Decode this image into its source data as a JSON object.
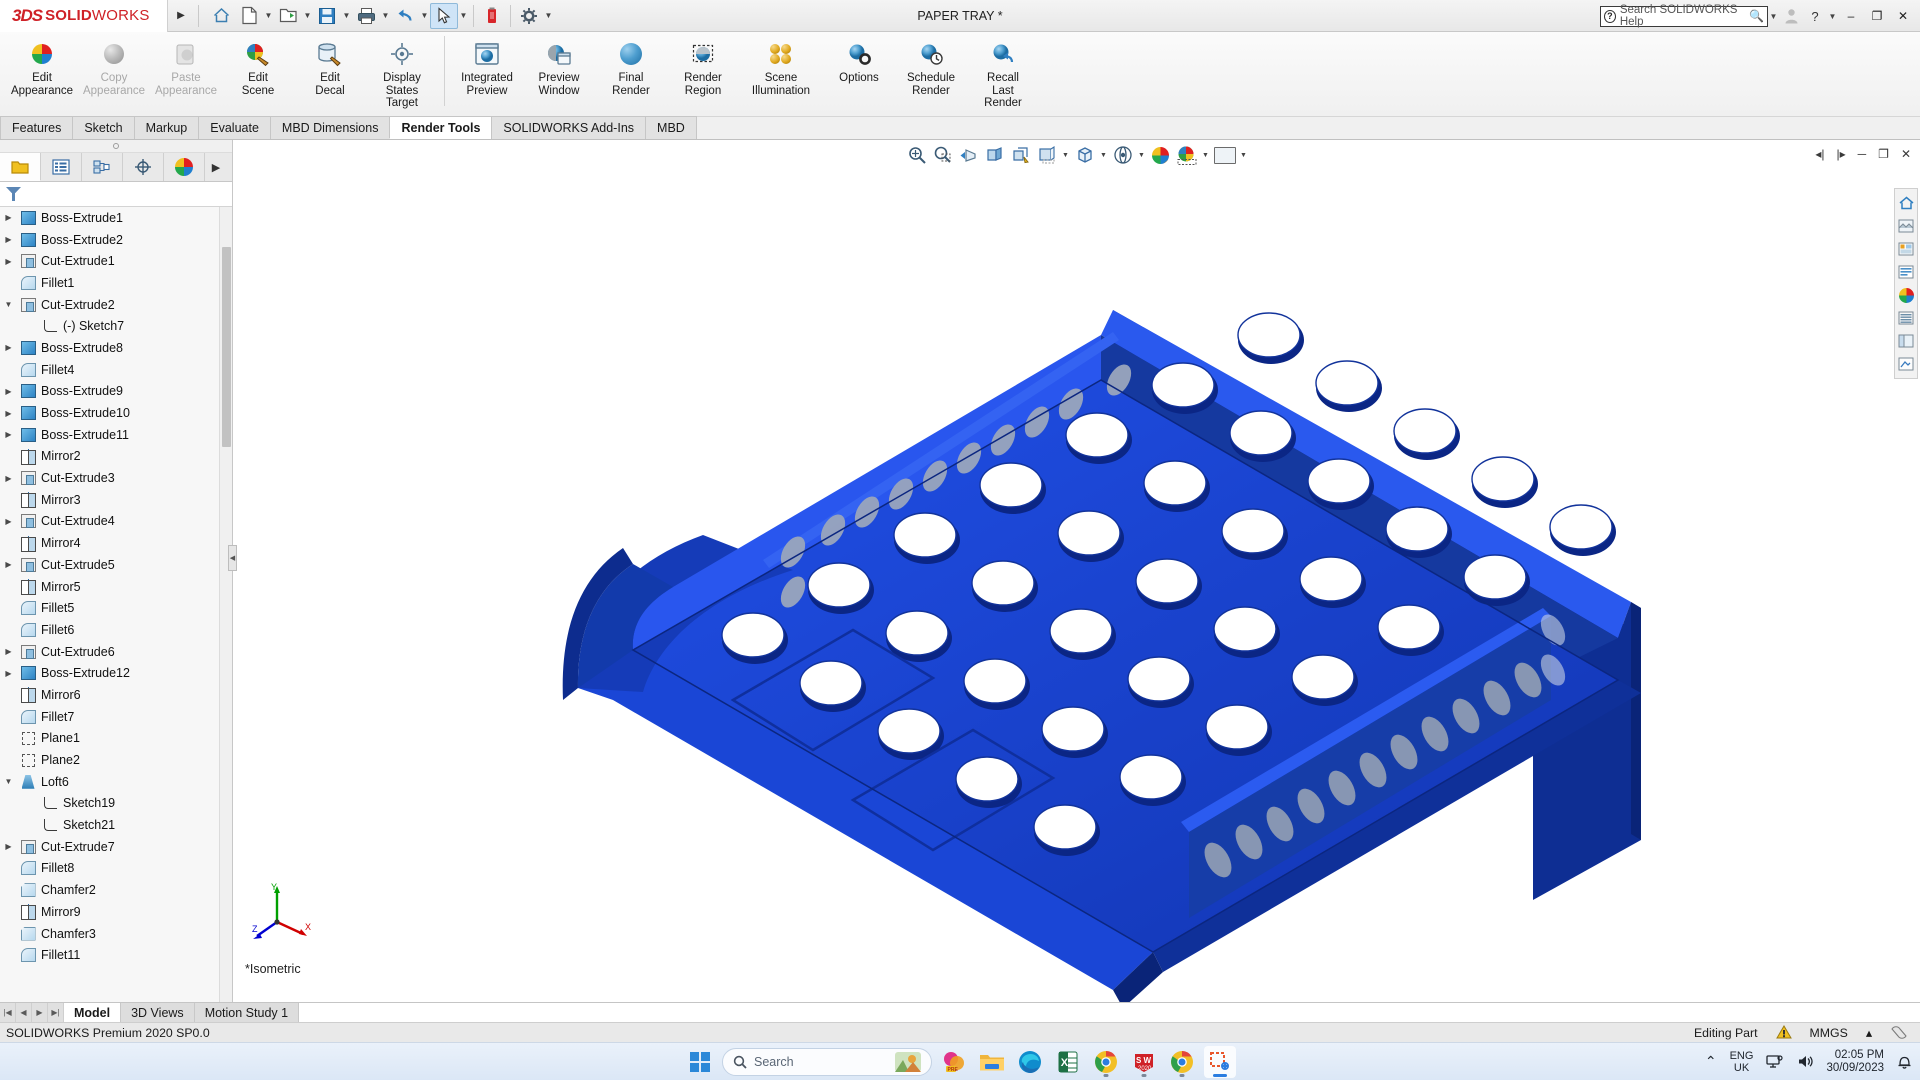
{
  "titlebar": {
    "brand_3ds": "3DS",
    "brand_name_bold": "SOLID",
    "brand_name_light": "WORKS",
    "document_title": "PAPER TRAY *",
    "help_search_placeholder": "Search SOLIDWORKS Help",
    "quick_access": [
      {
        "name": "home-icon",
        "label": "Home"
      },
      {
        "name": "new-document-icon",
        "label": "New"
      },
      {
        "name": "open-document-icon",
        "label": "Open"
      },
      {
        "name": "save-icon",
        "label": "Save"
      },
      {
        "name": "print-icon",
        "label": "Print"
      },
      {
        "name": "undo-icon",
        "label": "Undo"
      },
      {
        "name": "select-cursor-icon",
        "label": "Select"
      },
      {
        "name": "rebuild-icon",
        "label": "Rebuild"
      },
      {
        "name": "options-gear-icon",
        "label": "Options"
      }
    ],
    "window_controls": {
      "minimize": "–",
      "restore": "❐",
      "close": "✕"
    }
  },
  "ribbon": {
    "groups": [
      {
        "items": [
          {
            "label_line1": "Edit",
            "label_line2": "Appearance",
            "icon": "edit-appearance-icon",
            "disabled": false
          },
          {
            "label_line1": "Copy",
            "label_line2": "Appearance",
            "icon": "copy-appearance-icon",
            "disabled": true
          },
          {
            "label_line1": "Paste",
            "label_line2": "Appearance",
            "icon": "paste-appearance-icon",
            "disabled": true
          },
          {
            "label_line1": "Edit",
            "label_line2": "Scene",
            "icon": "edit-scene-icon",
            "disabled": false
          },
          {
            "label_line1": "Edit",
            "label_line2": "Decal",
            "icon": "edit-decal-icon",
            "disabled": false
          },
          {
            "label_line1": "Display",
            "label_line2": "States",
            "label_line3": "Target",
            "icon": "display-states-target-icon",
            "disabled": false
          }
        ]
      },
      {
        "items": [
          {
            "label_line1": "Integrated",
            "label_line2": "Preview",
            "icon": "integrated-preview-icon",
            "disabled": false
          },
          {
            "label_line1": "Preview",
            "label_line2": "Window",
            "icon": "preview-window-icon",
            "disabled": false
          },
          {
            "label_line1": "Final",
            "label_line2": "Render",
            "icon": "final-render-icon",
            "disabled": false
          },
          {
            "label_line1": "Render",
            "label_line2": "Region",
            "icon": "render-region-icon",
            "disabled": false
          },
          {
            "label_line1": "Scene",
            "label_line2": "Illumination",
            "icon": "scene-illumination-icon",
            "disabled": false
          },
          {
            "label_line1": "Options",
            "label_line2": "",
            "icon": "render-options-icon",
            "disabled": false
          },
          {
            "label_line1": "Schedule",
            "label_line2": "Render",
            "icon": "schedule-render-icon",
            "disabled": false
          },
          {
            "label_line1": "Recall",
            "label_line2": "Last",
            "label_line3": "Render",
            "icon": "recall-last-render-icon",
            "disabled": false
          }
        ]
      }
    ]
  },
  "command_tabs": [
    {
      "label": "Features",
      "active": false
    },
    {
      "label": "Sketch",
      "active": false
    },
    {
      "label": "Markup",
      "active": false
    },
    {
      "label": "Evaluate",
      "active": false
    },
    {
      "label": "MBD Dimensions",
      "active": false
    },
    {
      "label": "Render Tools",
      "active": true
    },
    {
      "label": "SOLIDWORKS Add-Ins",
      "active": false
    },
    {
      "label": "MBD",
      "active": false
    }
  ],
  "tree_tabs": [
    {
      "name": "feature-manager-tab",
      "active": true
    },
    {
      "name": "property-manager-tab",
      "active": false
    },
    {
      "name": "configuration-manager-tab",
      "active": false
    },
    {
      "name": "dimxpert-manager-tab",
      "active": false
    },
    {
      "name": "display-manager-tab",
      "active": false
    }
  ],
  "feature_tree": [
    {
      "label": "Boss-Extrude1",
      "icon": "boss-extrude-icon",
      "expandable": true,
      "expanded": false,
      "indent": 0
    },
    {
      "label": "Boss-Extrude2",
      "icon": "boss-extrude-icon",
      "expandable": true,
      "expanded": false,
      "indent": 0
    },
    {
      "label": "Cut-Extrude1",
      "icon": "cut-extrude-icon",
      "expandable": true,
      "expanded": false,
      "indent": 0
    },
    {
      "label": "Fillet1",
      "icon": "fillet-icon",
      "expandable": false,
      "expanded": false,
      "indent": 0
    },
    {
      "label": "Cut-Extrude2",
      "icon": "cut-extrude-icon",
      "expandable": true,
      "expanded": true,
      "indent": 0
    },
    {
      "label": "(-) Sketch7",
      "icon": "sketch-icon",
      "expandable": false,
      "expanded": false,
      "indent": 1
    },
    {
      "label": "Boss-Extrude8",
      "icon": "boss-extrude-icon",
      "expandable": true,
      "expanded": false,
      "indent": 0
    },
    {
      "label": "Fillet4",
      "icon": "fillet-icon",
      "expandable": false,
      "expanded": false,
      "indent": 0
    },
    {
      "label": "Boss-Extrude9",
      "icon": "boss-extrude-icon",
      "expandable": true,
      "expanded": false,
      "indent": 0
    },
    {
      "label": "Boss-Extrude10",
      "icon": "boss-extrude-icon",
      "expandable": true,
      "expanded": false,
      "indent": 0
    },
    {
      "label": "Boss-Extrude11",
      "icon": "boss-extrude-icon",
      "expandable": true,
      "expanded": false,
      "indent": 0
    },
    {
      "label": "Mirror2",
      "icon": "mirror-icon",
      "expandable": false,
      "expanded": false,
      "indent": 0
    },
    {
      "label": "Cut-Extrude3",
      "icon": "cut-extrude-icon",
      "expandable": true,
      "expanded": false,
      "indent": 0
    },
    {
      "label": "Mirror3",
      "icon": "mirror-icon",
      "expandable": false,
      "expanded": false,
      "indent": 0
    },
    {
      "label": "Cut-Extrude4",
      "icon": "cut-extrude-icon",
      "expandable": true,
      "expanded": false,
      "indent": 0
    },
    {
      "label": "Mirror4",
      "icon": "mirror-icon",
      "expandable": false,
      "expanded": false,
      "indent": 0
    },
    {
      "label": "Cut-Extrude5",
      "icon": "cut-extrude-icon",
      "expandable": true,
      "expanded": false,
      "indent": 0
    },
    {
      "label": "Mirror5",
      "icon": "mirror-icon",
      "expandable": false,
      "expanded": false,
      "indent": 0
    },
    {
      "label": "Fillet5",
      "icon": "fillet-icon",
      "expandable": false,
      "expanded": false,
      "indent": 0
    },
    {
      "label": "Fillet6",
      "icon": "fillet-icon",
      "expandable": false,
      "expanded": false,
      "indent": 0
    },
    {
      "label": "Cut-Extrude6",
      "icon": "cut-extrude-icon",
      "expandable": true,
      "expanded": false,
      "indent": 0
    },
    {
      "label": "Boss-Extrude12",
      "icon": "boss-extrude-icon",
      "expandable": true,
      "expanded": false,
      "indent": 0
    },
    {
      "label": "Mirror6",
      "icon": "mirror-icon",
      "expandable": false,
      "expanded": false,
      "indent": 0
    },
    {
      "label": "Fillet7",
      "icon": "fillet-icon",
      "expandable": false,
      "expanded": false,
      "indent": 0
    },
    {
      "label": "Plane1",
      "icon": "plane-icon",
      "expandable": false,
      "expanded": false,
      "indent": 0
    },
    {
      "label": "Plane2",
      "icon": "plane-icon",
      "expandable": false,
      "expanded": false,
      "indent": 0
    },
    {
      "label": "Loft6",
      "icon": "loft-icon",
      "expandable": true,
      "expanded": true,
      "indent": 0
    },
    {
      "label": "Sketch19",
      "icon": "sketch-icon",
      "expandable": false,
      "expanded": false,
      "indent": 1
    },
    {
      "label": "Sketch21",
      "icon": "sketch-icon",
      "expandable": false,
      "expanded": false,
      "indent": 1
    },
    {
      "label": "Cut-Extrude7",
      "icon": "cut-extrude-icon",
      "expandable": true,
      "expanded": false,
      "indent": 0
    },
    {
      "label": "Fillet8",
      "icon": "fillet-icon",
      "expandable": false,
      "expanded": false,
      "indent": 0
    },
    {
      "label": "Chamfer2",
      "icon": "chamfer-icon",
      "expandable": false,
      "expanded": false,
      "indent": 0
    },
    {
      "label": "Mirror9",
      "icon": "mirror-icon",
      "expandable": false,
      "expanded": false,
      "indent": 0
    },
    {
      "label": "Chamfer3",
      "icon": "chamfer-icon",
      "expandable": false,
      "expanded": false,
      "indent": 0
    },
    {
      "label": "Fillet11",
      "icon": "fillet-icon",
      "expandable": false,
      "expanded": false,
      "indent": 0
    }
  ],
  "view_toolbar": [
    {
      "name": "zoom-to-fit-icon"
    },
    {
      "name": "zoom-to-area-icon"
    },
    {
      "name": "previous-view-icon"
    },
    {
      "name": "section-view-icon"
    },
    {
      "name": "view-orientation-icon"
    },
    {
      "name": "display-style-icon"
    },
    {
      "name": "hide-show-items-icon"
    },
    {
      "name": "edit-appearance-icon"
    },
    {
      "name": "apply-scene-icon"
    },
    {
      "name": "view-settings-icon"
    }
  ],
  "view_toolbar_right": [
    {
      "name": "collapse-left-icon"
    },
    {
      "name": "expand-right-icon"
    },
    {
      "name": "restore-window-icon"
    },
    {
      "name": "close-window-icon"
    }
  ],
  "right_dock": [
    {
      "name": "view-home-icon"
    },
    {
      "name": "appearances-icon"
    },
    {
      "name": "scenes-icon"
    },
    {
      "name": "decals-icon"
    },
    {
      "name": "custom-view-icon"
    },
    {
      "name": "render-palette-icon"
    },
    {
      "name": "display-pane-icon"
    },
    {
      "name": "annotations-icon"
    }
  ],
  "graphics": {
    "view_label": "*Isometric",
    "model_color": "#1640d8",
    "model_name": "paper-tray-3d-model",
    "triad_axes": [
      {
        "axis": "Y",
        "color": "#00a000"
      },
      {
        "axis": "X",
        "color": "#d00000"
      },
      {
        "axis": "Z",
        "color": "#0000d0"
      }
    ]
  },
  "model_tabs": [
    {
      "label": "Model",
      "active": true
    },
    {
      "label": "3D Views",
      "active": false
    },
    {
      "label": "Motion Study 1",
      "active": false
    }
  ],
  "statusbar": {
    "version": "SOLIDWORKS Premium 2020 SP0.0",
    "edit_state": "Editing Part",
    "units": "MMGS",
    "units_caret": "▴"
  },
  "taskbar": {
    "search_placeholder": "Search",
    "apps": [
      {
        "name": "photos-icon",
        "label": "Photos"
      },
      {
        "name": "powerpoint-icon",
        "label": "PowerPoint"
      },
      {
        "name": "file-explorer-icon",
        "label": "File Explorer"
      },
      {
        "name": "microsoft-edge-icon",
        "label": "Microsoft Edge"
      },
      {
        "name": "excel-icon",
        "label": "Excel"
      },
      {
        "name": "google-chrome-icon",
        "label": "Google Chrome",
        "running": true
      },
      {
        "name": "solidworks-2020-icon",
        "label": "SOLIDWORKS 2020",
        "running": true
      },
      {
        "name": "google-chrome-icon-2",
        "label": "Google Chrome",
        "running": true
      },
      {
        "name": "snipping-tool-icon",
        "label": "Snipping Tool",
        "running": true,
        "active": true
      }
    ],
    "tray": {
      "chevron": "⌃",
      "language_line1": "ENG",
      "language_line2": "UK",
      "time": "02:05 PM",
      "date": "30/09/2023"
    }
  }
}
